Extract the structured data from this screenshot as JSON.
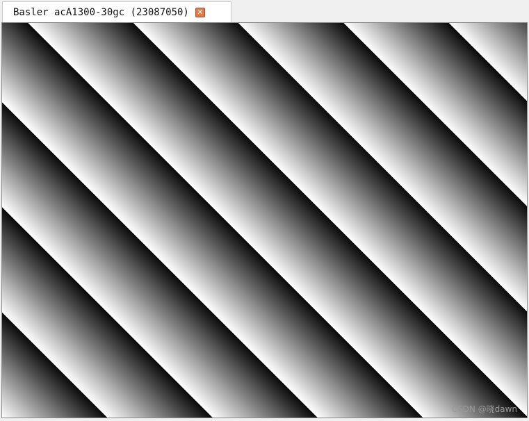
{
  "tab": {
    "title": "Basler acA1300-30gc (23087050)",
    "close_glyph": "✕",
    "close_icon": "close-icon",
    "close_color": "#e07a48"
  },
  "viewport": {
    "pattern": "diagonal grayscale test pattern"
  },
  "watermark": {
    "text": "CSDN @晓dawn"
  }
}
